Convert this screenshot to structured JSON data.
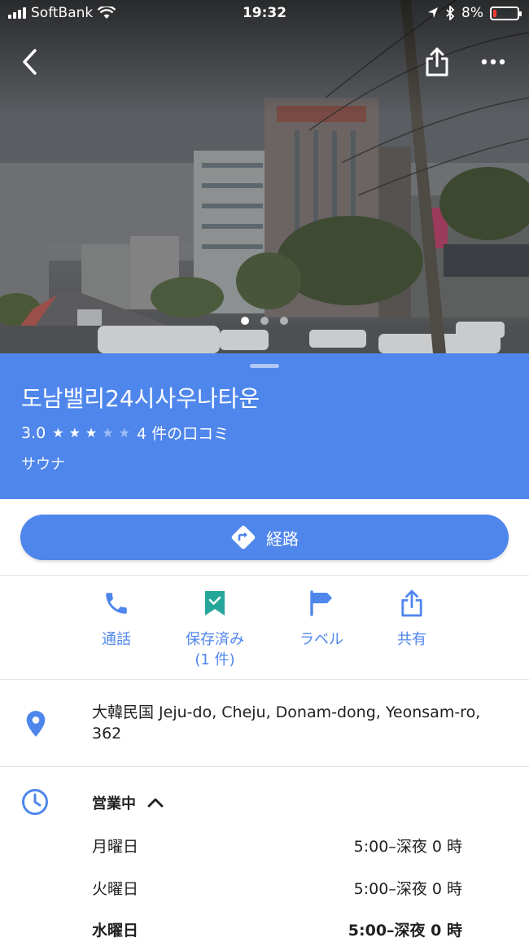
{
  "status_bar": {
    "carrier": "SoftBank",
    "time": "19:32",
    "battery": "8%"
  },
  "hero": {
    "photo_count": 3,
    "active_photo": 1
  },
  "place": {
    "name": "도남밸리24시사우나타운",
    "rating": "3.0",
    "stars_filled": 3,
    "stars_total": 5,
    "reviews": "4 件の口コミ",
    "category": "サウナ"
  },
  "directions": {
    "label": "経路"
  },
  "actions": [
    {
      "label": "通話",
      "icon": "phone-icon"
    },
    {
      "label": "保存済み",
      "sub": "(1 件)",
      "icon": "bookmark-check-icon"
    },
    {
      "label": "ラベル",
      "icon": "flag-icon"
    },
    {
      "label": "共有",
      "icon": "share-icon"
    }
  ],
  "address": {
    "text": "大韓民国 Jeju-do, Cheju, Donam-dong, Yeonsam-ro, 362"
  },
  "hours": {
    "status": "営業中",
    "rows": [
      {
        "day": "月曜日",
        "time": "5:00–深夜 0 時"
      },
      {
        "day": "火曜日",
        "time": "5:00–深夜 0 時"
      },
      {
        "day": "水曜日",
        "time": "5:00–深夜 0 時"
      }
    ]
  },
  "colors": {
    "accent": "#4f86ec",
    "text": "#212121"
  }
}
